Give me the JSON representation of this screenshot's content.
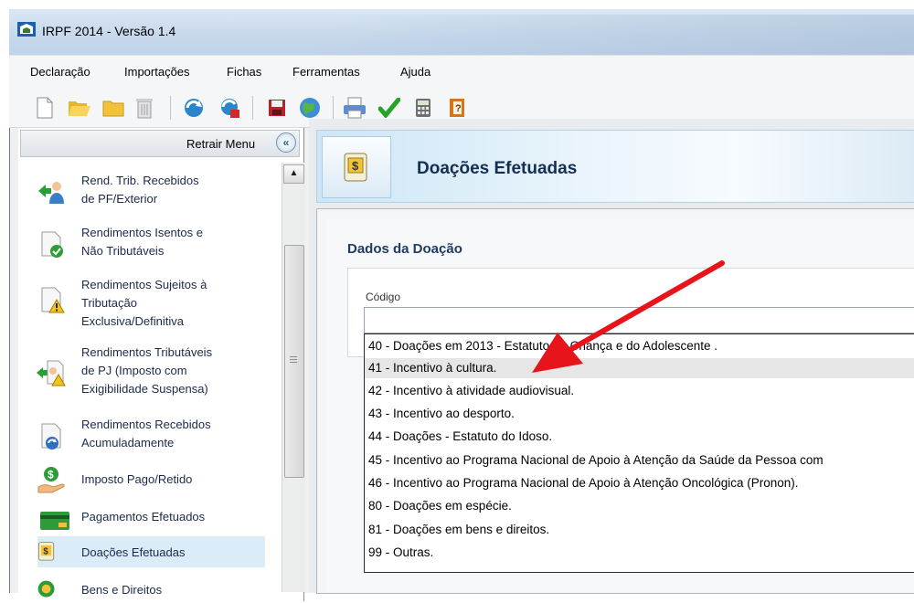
{
  "window": {
    "title": "IRPF 2014 - Versão 1.4"
  },
  "menu": [
    "Declaração",
    "Importações",
    "Fichas",
    "Ferramentas",
    "Ajuda"
  ],
  "toolbar": {
    "icons": [
      "new-document-icon",
      "open-folder-icon",
      "folder-icon",
      "trash-icon",
      "transmit-icon",
      "receive-icon",
      "save-icon",
      "globe-icon",
      "print-icon",
      "check-icon",
      "calculator-icon",
      "info-book-icon"
    ]
  },
  "sidebar": {
    "retract_label": "Retrair Menu",
    "retract_icon": "«",
    "items": [
      {
        "lines": [
          "Rend. Trib. Recebidos",
          "de PF/Exterior"
        ],
        "icon": "person-arrow-icon"
      },
      {
        "lines": [
          "Rendimentos Isentos e",
          "Não Tributáveis"
        ],
        "icon": "doc-check-icon"
      },
      {
        "lines": [
          "Rendimentos Sujeitos à",
          "Tributação",
          "Exclusiva/Definitiva"
        ],
        "icon": "doc-warning-icon"
      },
      {
        "lines": [
          "Rendimentos Tributáveis",
          "de PJ (Imposto com",
          "Exigibilidade Suspensa)"
        ],
        "icon": "person-warning-icon"
      },
      {
        "lines": [
          "Rendimentos Recebidos",
          "Acumuladamente"
        ],
        "icon": "doc-refresh-icon"
      },
      {
        "lines": [
          "Imposto Pago/Retido"
        ],
        "icon": "coin-hand-icon"
      },
      {
        "lines": [
          "Pagamentos Efetuados"
        ],
        "icon": "credit-card-icon"
      },
      {
        "lines": [
          "Doações Efetuadas"
        ],
        "icon": "money-bag-icon"
      },
      {
        "lines": [
          "Bens e Direitos"
        ],
        "icon": "coin-icon"
      }
    ]
  },
  "header": {
    "title": "Doações Efetuadas"
  },
  "form": {
    "section_title": "Dados da Doação",
    "code_label": "Código",
    "code_value": "",
    "options": [
      "40 - Doações em 2013 - Estatuto da Criança e do Adolescente .",
      "41 - Incentivo à cultura.",
      "42 - Incentivo à atividade audiovisual.",
      "43 - Incentivo ao desporto.",
      "44 - Doações - Estatuto do Idoso.",
      "45 - Incentivo ao Programa Nacional de Apoio à Atenção da Saúde da Pessoa com",
      "46 - Incentivo ao Programa Nacional de Apoio à Atenção Oncológica (Pronon).",
      "80 - Doações em espécie.",
      "81 - Doações em bens e direitos.",
      "99 - Outras."
    ],
    "highlighted_index": 1
  },
  "colors": {
    "selection": "#d9ecf8",
    "header_title": "#152f52",
    "annotation_arrow": "#e8141b"
  }
}
